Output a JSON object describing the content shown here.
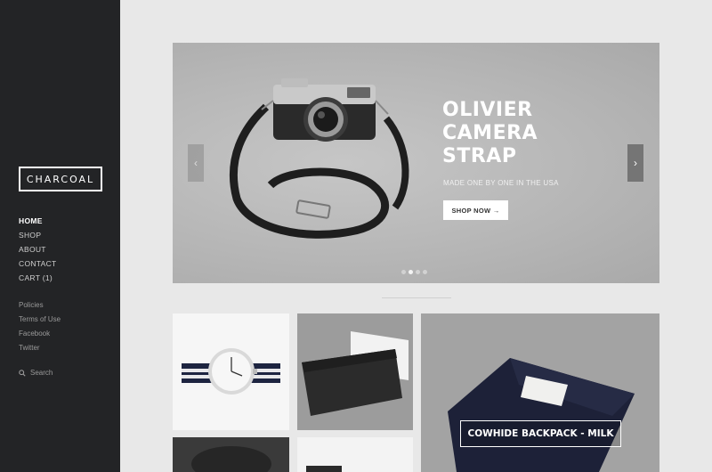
{
  "brand": {
    "logo": "CHARCOAL"
  },
  "nav": {
    "items": [
      {
        "label": "HOME"
      },
      {
        "label": "SHOP"
      },
      {
        "label": "ABOUT"
      },
      {
        "label": "CONTACT"
      },
      {
        "label": "CART (1)"
      }
    ]
  },
  "subnav": {
    "items": [
      {
        "label": "Policies"
      },
      {
        "label": "Terms of Use"
      },
      {
        "label": "Facebook"
      },
      {
        "label": "Twitter"
      }
    ]
  },
  "search": {
    "label": "Search",
    "icon": "search-icon"
  },
  "slider": {
    "title_lines": [
      "OLIVIER",
      "CAMERA",
      "STRAP"
    ],
    "subtitle": "MADE ONE BY ONE IN THE USA",
    "cta": "SHOP NOW →",
    "prev_icon": "chevron-left-icon",
    "next_icon": "chevron-right-icon",
    "slide_count": 4,
    "active_slide": 2
  },
  "products": {
    "featured_label": "COWHIDE BACKPACK - MILK"
  },
  "colors": {
    "sidebar_bg": "#232426",
    "page_bg": "#e8e8e8",
    "accent": "#ffffff"
  }
}
